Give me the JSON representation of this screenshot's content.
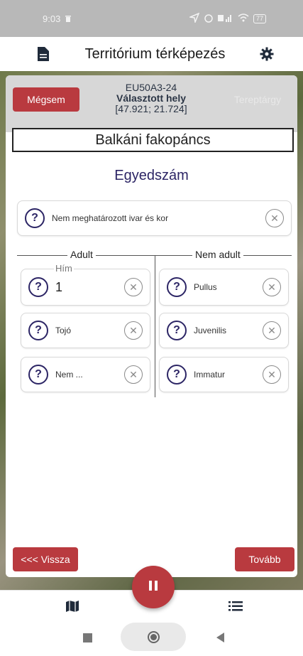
{
  "status_bar": {
    "time": "9:03",
    "battery": "77"
  },
  "app_bar": {
    "title": "Territórium térképezés",
    "left_icon": "document-icon",
    "right_icon": "gear-icon"
  },
  "header": {
    "cancel_label": "Mégsem",
    "feature_label": "Tereptárgy",
    "location_code": "EU50A3-24",
    "location_label": "Választott hely",
    "coordinates": "[47.921; 21.724]"
  },
  "species": "Balkáni fakopáncs",
  "section_title": "Egyedszám",
  "unknown_row": {
    "label": "Nem meghatározott ivar és kor"
  },
  "adult": {
    "heading": "Adult",
    "male_field_label": "Hím",
    "male_value": "1",
    "female_label": "Tojó",
    "unknown_label": "Nem ..."
  },
  "non_adult": {
    "heading": "Nem adult",
    "items": [
      "Pullus",
      "Juvenilis",
      "Immatur"
    ]
  },
  "footer": {
    "back_label": "<<< Vissza",
    "next_label": "Tovább"
  },
  "colors": {
    "accent_red": "#b93a3f",
    "navy": "#2c2565"
  }
}
